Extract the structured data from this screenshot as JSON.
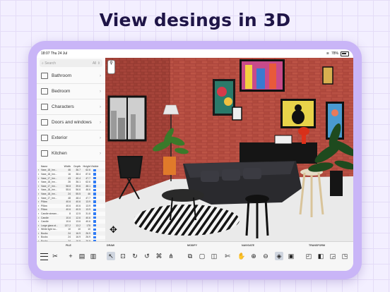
{
  "headline": "View desings in 3D",
  "status": {
    "time": "18:07",
    "date": "Thu 24 Jul",
    "battery": "78%"
  },
  "search": {
    "placeholder": "Search",
    "filter": "All"
  },
  "categories": [
    {
      "label": "Bathroom",
      "icon": "bathroom-icon"
    },
    {
      "label": "Bedroom",
      "icon": "bedroom-icon"
    },
    {
      "label": "Characters",
      "icon": "characters-icon"
    },
    {
      "label": "Doors and windows",
      "icon": "doors-icon"
    },
    {
      "label": "Exterior",
      "icon": "exterior-icon"
    },
    {
      "label": "Kitchen",
      "icon": "kitchen-icon"
    }
  ],
  "object_table": {
    "headers": [
      "Name",
      "Width",
      "Depth",
      "Height",
      "Visible"
    ],
    "rows": [
      [
        "Vase_18_Inn...",
        "46",
        "36.7",
        "62.6"
      ],
      [
        "Vase_18_Inn...",
        "16",
        "38.4",
        "87.8"
      ],
      [
        "Vase_17_Inn...",
        "43",
        "40.4",
        "47.7"
      ],
      [
        "Vase_18_Inn...",
        "26",
        "36.1",
        "62.6"
      ],
      [
        "Vase_17_Inn...",
        "58.8",
        "39.6",
        "48.1"
      ],
      [
        "Vase_18_Inn...",
        "55.6",
        "56.6",
        "46.6"
      ],
      [
        "Vase_18_Inn...",
        "24",
        "55.5",
        "46"
      ],
      [
        "Vase_17_Inn...",
        "48",
        "48.4",
        "47.7"
      ],
      [
        "Pillow",
        "40.6",
        "40.6",
        "13.9"
      ],
      [
        "Pillow",
        "40.6",
        "40.6",
        "13.9"
      ],
      [
        "Pillow",
        "40.6",
        "40.5",
        "13.9"
      ],
      [
        "Candle stream...",
        "8",
        "12.5",
        "31.8"
      ],
      [
        "Candle",
        "10.6",
        "12.6",
        "40.6"
      ],
      [
        "Candle",
        "10.6",
        "13.6",
        "40.6"
      ],
      [
        "Large glass st...",
        "137.2",
        "13.2",
        "175"
      ],
      [
        "White light no...",
        "10",
        "10",
        "10"
      ],
      [
        "Books",
        "24",
        "16.9",
        "26.9"
      ],
      [
        "Books",
        "24",
        "16.9",
        "26.9"
      ],
      [
        "Books",
        "24",
        "16.9",
        "26.9"
      ],
      [
        "Books",
        "24",
        "16.9",
        "26.9"
      ]
    ]
  },
  "toolbar": {
    "groups": {
      "file": "FILE",
      "draw": "DRAW",
      "modify": "MODIFY",
      "navigate": "NAVIGATE",
      "transform": "TRANSFORM"
    },
    "buttons": [
      "menu-icon",
      "tools-icon",
      "add-icon",
      "open-icon",
      "save-icon",
      "select-icon",
      "create-walls-icon",
      "create-rooms-icon",
      "create-polylines-icon",
      "create-dimensions-icon",
      "create-labels-icon",
      "copy-icon",
      "paste-icon",
      "paste-style-icon",
      "cut-icon",
      "pan-icon",
      "zoom-in-icon",
      "zoom-out-icon",
      "3d-view-icon",
      "aerial-view-icon",
      "rotate-icon",
      "flip-icon",
      "resize-icon",
      "align-icon"
    ]
  },
  "colors": {
    "device": "#c9b5f7",
    "accent": "#2f7bf5",
    "brick": "#b5473a",
    "headline": "#1f1547"
  }
}
